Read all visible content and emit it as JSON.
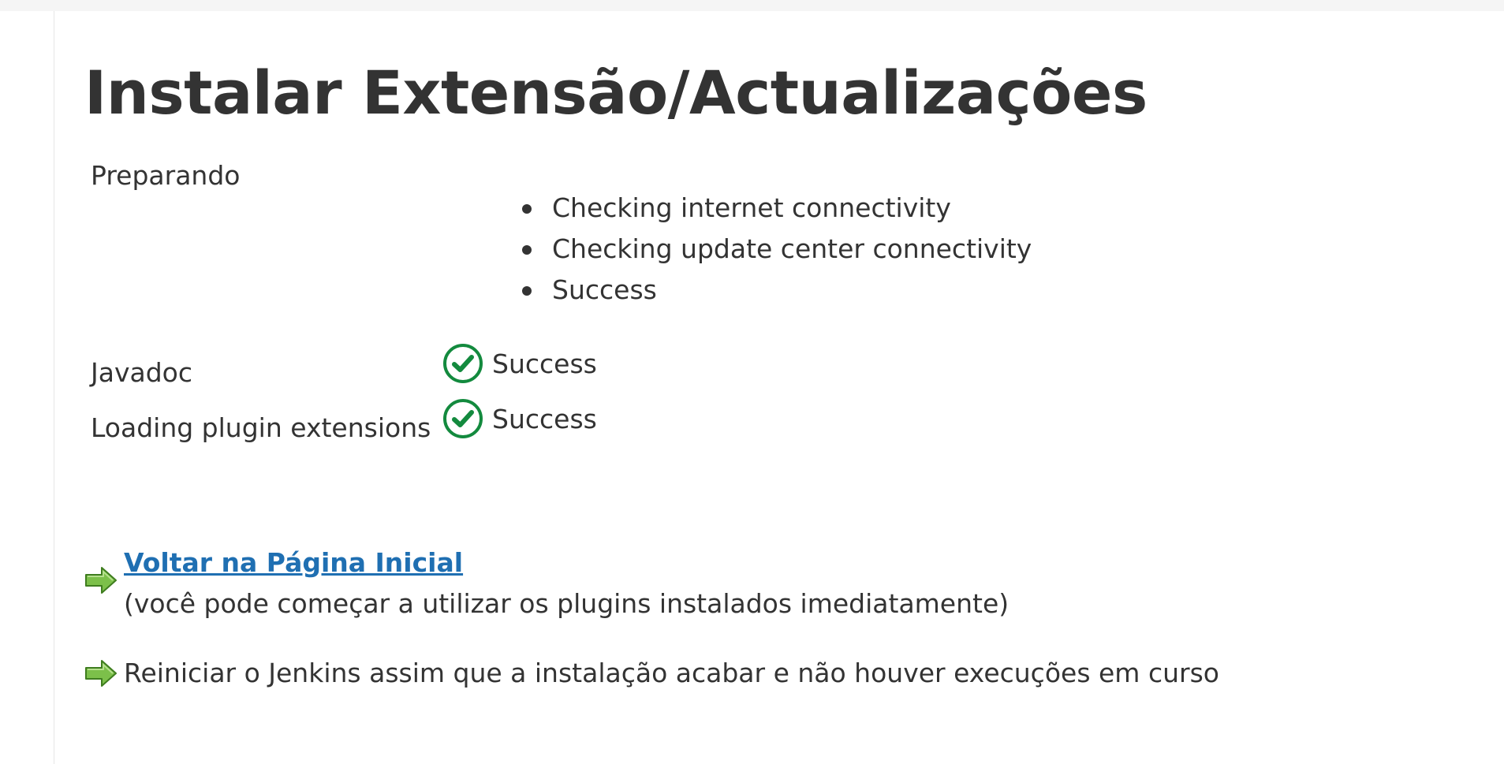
{
  "page": {
    "title": "Instalar Extensão/Actualizações"
  },
  "install_rows": [
    {
      "label": "Preparando",
      "steps": [
        "Checking internet connectivity",
        "Checking update center connectivity",
        "Success"
      ]
    },
    {
      "label": "Javadoc",
      "status": "Success",
      "status_icon": "check-circle-icon"
    },
    {
      "label": "Loading plugin extensions",
      "status": "Success",
      "status_icon": "check-circle-icon"
    }
  ],
  "actions": {
    "home_link": "Voltar na Página Inicial",
    "home_note": "(você pode começar a utilizar os plugins instalados imediatamente)",
    "restart_label": "Reiniciar o Jenkins assim que a instalação acabar e não houver execuções em curso",
    "arrow_icon": "green-arrow-right-icon"
  },
  "colors": {
    "success_green": "#138a3e",
    "arrow_green": "#6db33f",
    "link_blue": "#1f6fb2",
    "text": "#333333"
  }
}
